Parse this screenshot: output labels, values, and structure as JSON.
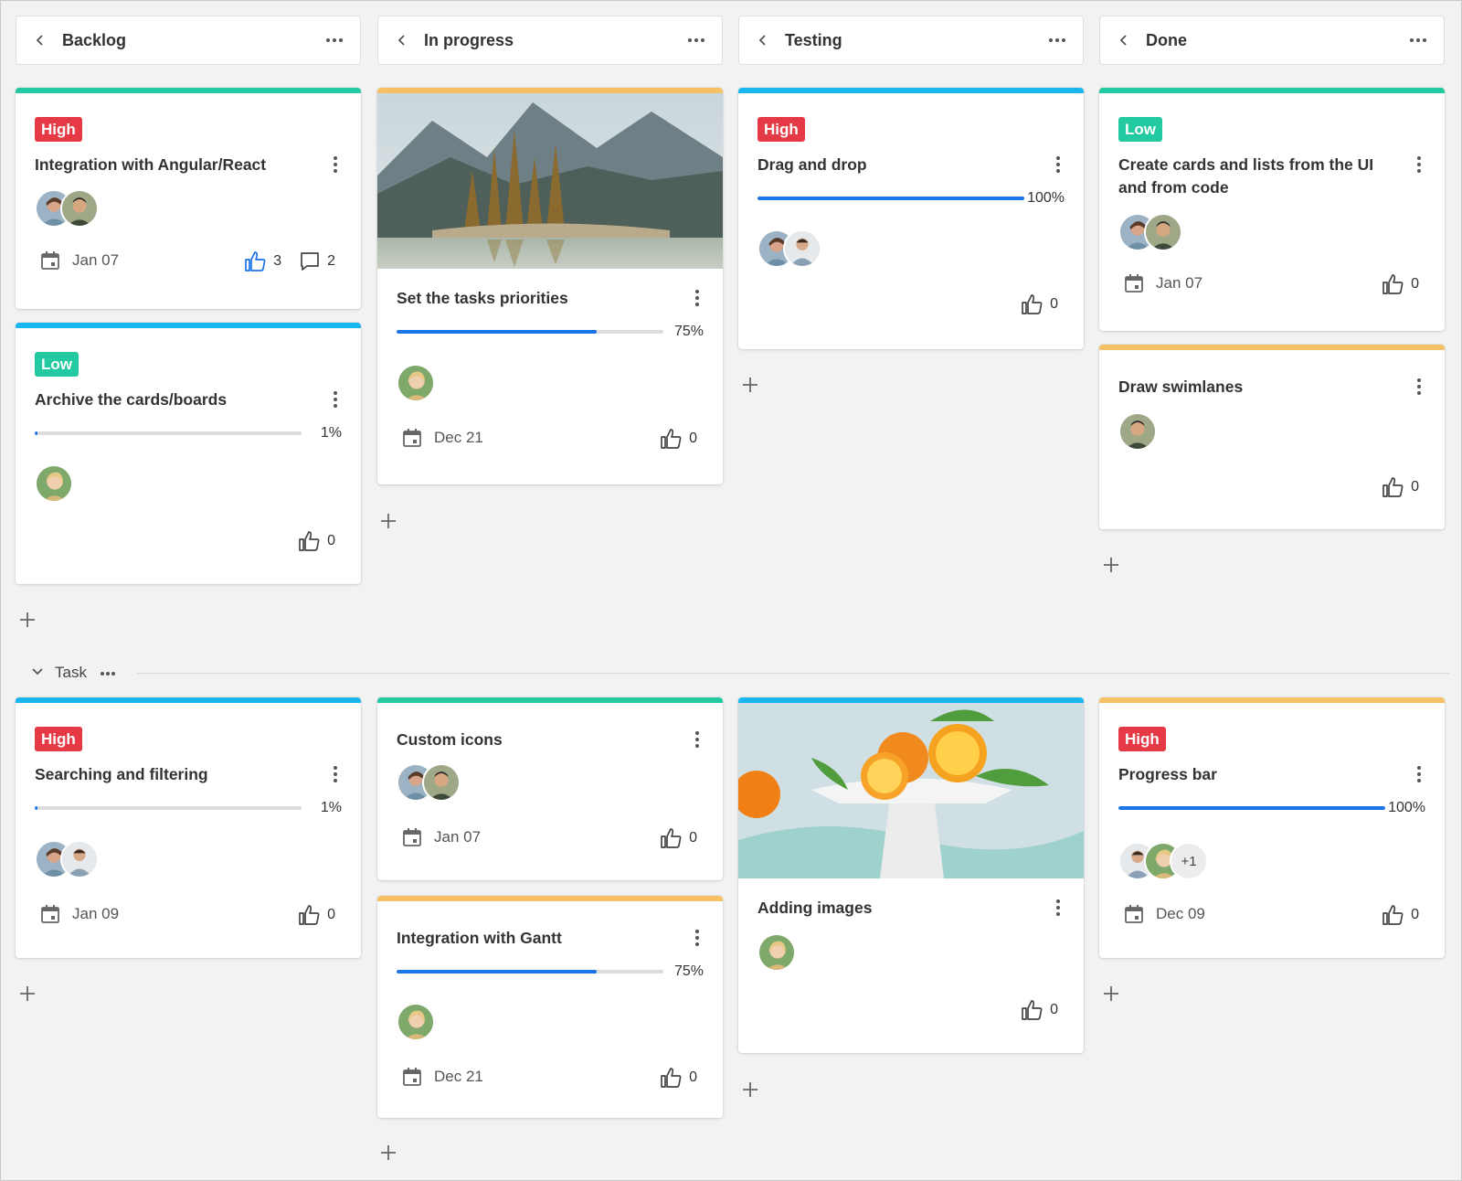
{
  "colors": {
    "green": "#22c9a1",
    "blue": "#1ab6f0",
    "yellow": "#f6c064",
    "high": "#e63946",
    "low": "#22c9a1",
    "progress": "#1a73e8",
    "like_active": "#1a73e8"
  },
  "columns": [
    {
      "title": "Backlog"
    },
    {
      "title": "In progress"
    },
    {
      "title": "Testing"
    },
    {
      "title": "Done"
    }
  ],
  "swimlane": {
    "title": "Task"
  },
  "cards": {
    "c1": {
      "priority": "High",
      "title": "Integration with Angular/React",
      "date": "Jan 07",
      "likes": "3",
      "comments": "2",
      "stripe": "green"
    },
    "c2": {
      "priority": "Low",
      "title": "Archive the cards/boards",
      "progress_pct": "1%",
      "progress": 0.01,
      "likes": "0",
      "stripe": "blue"
    },
    "c3": {
      "title": "Set the tasks priorities",
      "progress_pct": "75%",
      "progress": 0.75,
      "date": "Dec 21",
      "likes": "0",
      "stripe": "yellow",
      "image": "mountain-lake"
    },
    "c4": {
      "priority": "High",
      "title": "Drag and drop",
      "progress_pct": "100%",
      "progress": 1.0,
      "likes": "0",
      "stripe": "blue"
    },
    "c5": {
      "priority": "Low",
      "title": "Create cards and lists from the UI and from code",
      "date": "Jan 07",
      "likes": "0",
      "stripe": "green"
    },
    "c6": {
      "title": "Draw swimlanes",
      "likes": "0",
      "stripe": "yellow"
    },
    "c7": {
      "priority": "High",
      "title": "Searching and filtering",
      "progress_pct": "1%",
      "progress": 0.01,
      "date": "Jan 09",
      "likes": "0",
      "stripe": "blue"
    },
    "c8": {
      "title": "Custom icons",
      "date": "Jan 07",
      "likes": "0",
      "stripe": "green"
    },
    "c9": {
      "title": "Integration with Gantt",
      "progress_pct": "75%",
      "progress": 0.75,
      "date": "Dec 21",
      "likes": "0",
      "stripe": "yellow"
    },
    "c10": {
      "title": "Adding images",
      "likes": "0",
      "stripe": "blue",
      "image": "oranges"
    },
    "c11": {
      "priority": "High",
      "title": "Progress bar",
      "progress_pct": "100%",
      "progress": 1.0,
      "extra_users": "+1",
      "date": "Dec 09",
      "likes": "0",
      "stripe": "yellow"
    }
  }
}
